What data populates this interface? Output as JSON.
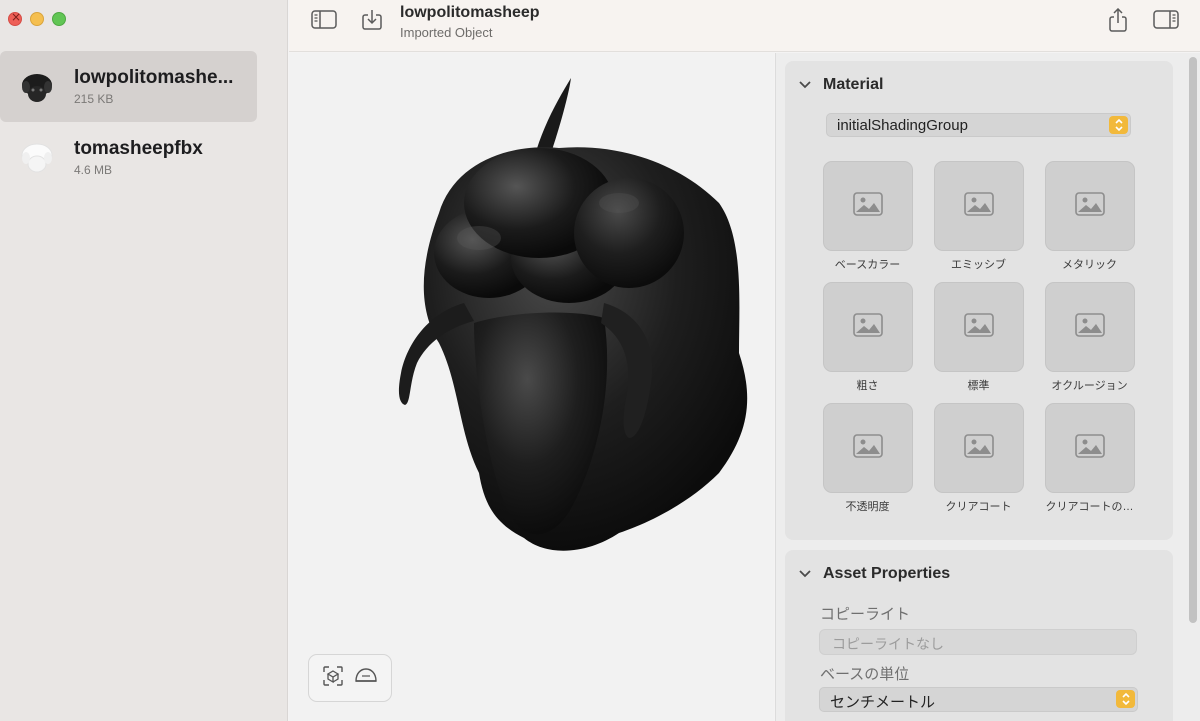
{
  "window": {
    "controls": [
      "close",
      "minimize",
      "maximize"
    ]
  },
  "sidebar": {
    "files": [
      {
        "name": "lowpolitomashe...",
        "size": "215 KB",
        "selected": true,
        "thumb": "black-sheep-thumbnail-icon"
      },
      {
        "name": "tomasheepfbx",
        "size": "4.6 MB",
        "selected": false,
        "thumb": "white-sheep-thumbnail-icon"
      }
    ]
  },
  "toolbar": {
    "title": "lowpolitomasheep",
    "subtitle": "Imported Object",
    "icons": [
      "sidebar-toggle-icon",
      "import-icon",
      "share-icon",
      "inspector-toggle-icon"
    ]
  },
  "viewport": {
    "controls": [
      "frame-object-icon",
      "environment-icon"
    ]
  },
  "inspector": {
    "material": {
      "title": "Material",
      "shading_group": "initialShadingGroup",
      "textures": [
        "ベースカラー",
        "エミッシブ",
        "メタリック",
        "粗さ",
        "標準",
        "オクルージョン",
        "不透明度",
        "クリアコート",
        "クリアコートの…"
      ]
    },
    "asset_properties": {
      "title": "Asset Properties",
      "copyright_label": "コピーライト",
      "copyright_placeholder": "コピーライトなし",
      "base_unit_label": "ベースの単位",
      "base_unit_value": "センチメートル"
    }
  },
  "colors": {
    "accent": "#f2b93b",
    "sidebar_bg": "#e9e6e4",
    "selected_row": "#d5d1cf",
    "model": "#1a1a1a"
  }
}
